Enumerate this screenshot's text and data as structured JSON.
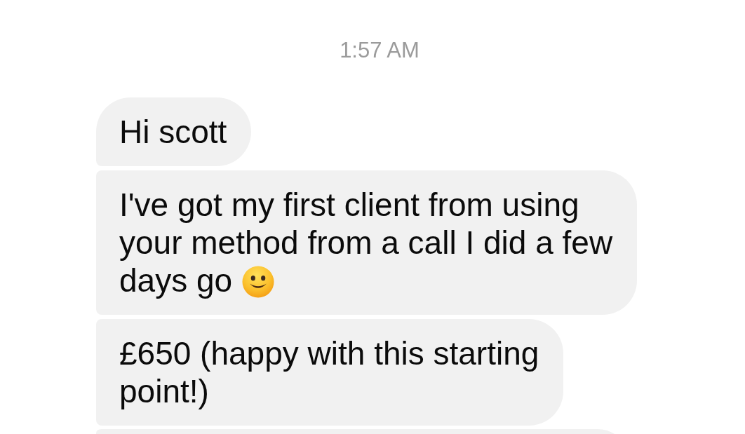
{
  "timestamp": "1:57 AM",
  "messages": [
    {
      "kind": "text",
      "text": "Hi scott",
      "trailing_emoji": false
    },
    {
      "kind": "text",
      "text": "I've got my first client from using your method from a call I did a few days go",
      "trailing_emoji": true
    },
    {
      "kind": "text",
      "text": "£650 (happy with this starting point!)",
      "trailing_emoji": false
    },
    {
      "kind": "cut_off"
    }
  ]
}
